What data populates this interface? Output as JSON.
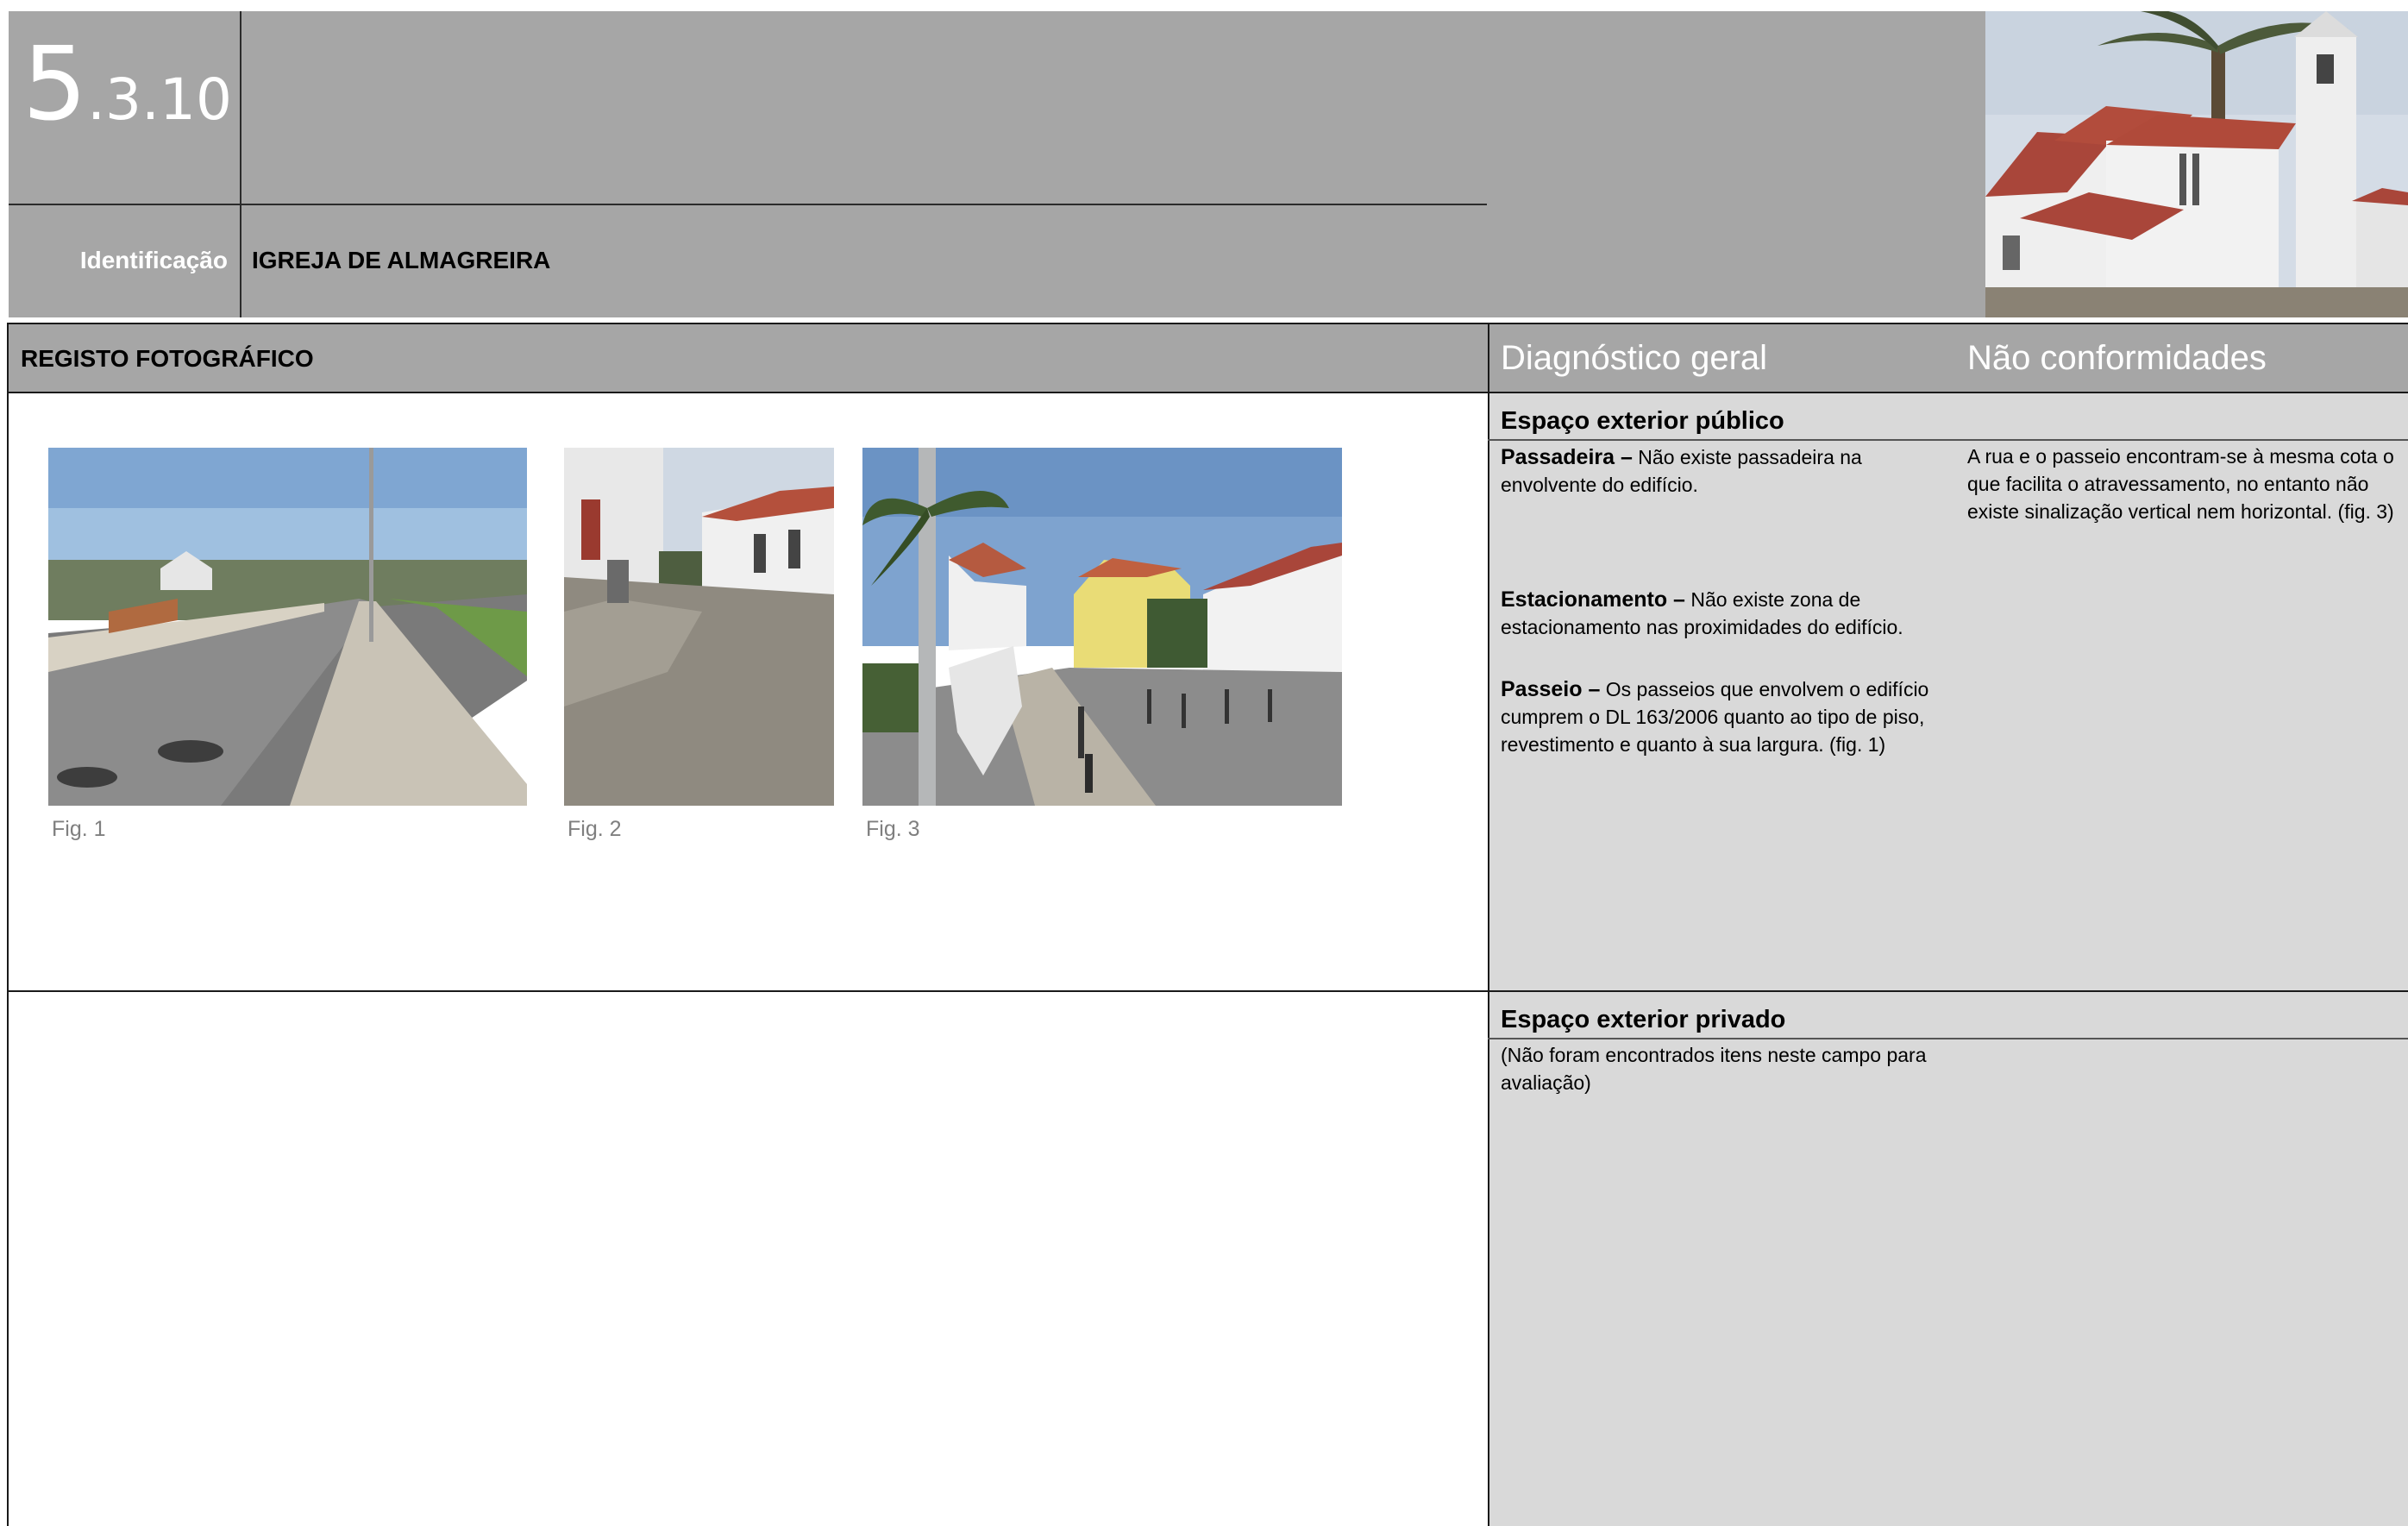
{
  "header": {
    "section_main": "5",
    "section_sub": ".3.10",
    "identification_label": "Identificação",
    "identification_value": "IGREJA DE ALMAGREIRA"
  },
  "left": {
    "title": "REGISTO FOTOGRÁFICO",
    "figures": [
      {
        "caption": "Fig. 1"
      },
      {
        "caption": "Fig. 2"
      },
      {
        "caption": "Fig. 3"
      }
    ]
  },
  "right": {
    "diagnostico_title": "Diagnóstico geral",
    "nc_title": "Não conformidades",
    "public": {
      "heading": "Espaço exterior público",
      "items": [
        {
          "term": "Passadeira –",
          "text": " Não existe passadeira na envolvente do edifício."
        },
        {
          "term": "Estacionamento –",
          "text": " Não existe zona de estacionamento nas proximidades do edifício."
        },
        {
          "term": "Passeio –",
          "text": " Os passeios que envolvem o edifício cumprem o DL 163/2006 quanto ao tipo de piso, revestimento e quanto à sua largura. (fig. 1)"
        }
      ],
      "nc_text": "A rua e o passeio encontram-se à mesma cota o que facilita o atravessamento, no entanto não existe sinalização vertical nem horizontal. (fig. 3)"
    },
    "private": {
      "heading": "Espaço exterior privado",
      "text": "(Não foram encontrados itens neste campo para avaliação)"
    }
  }
}
